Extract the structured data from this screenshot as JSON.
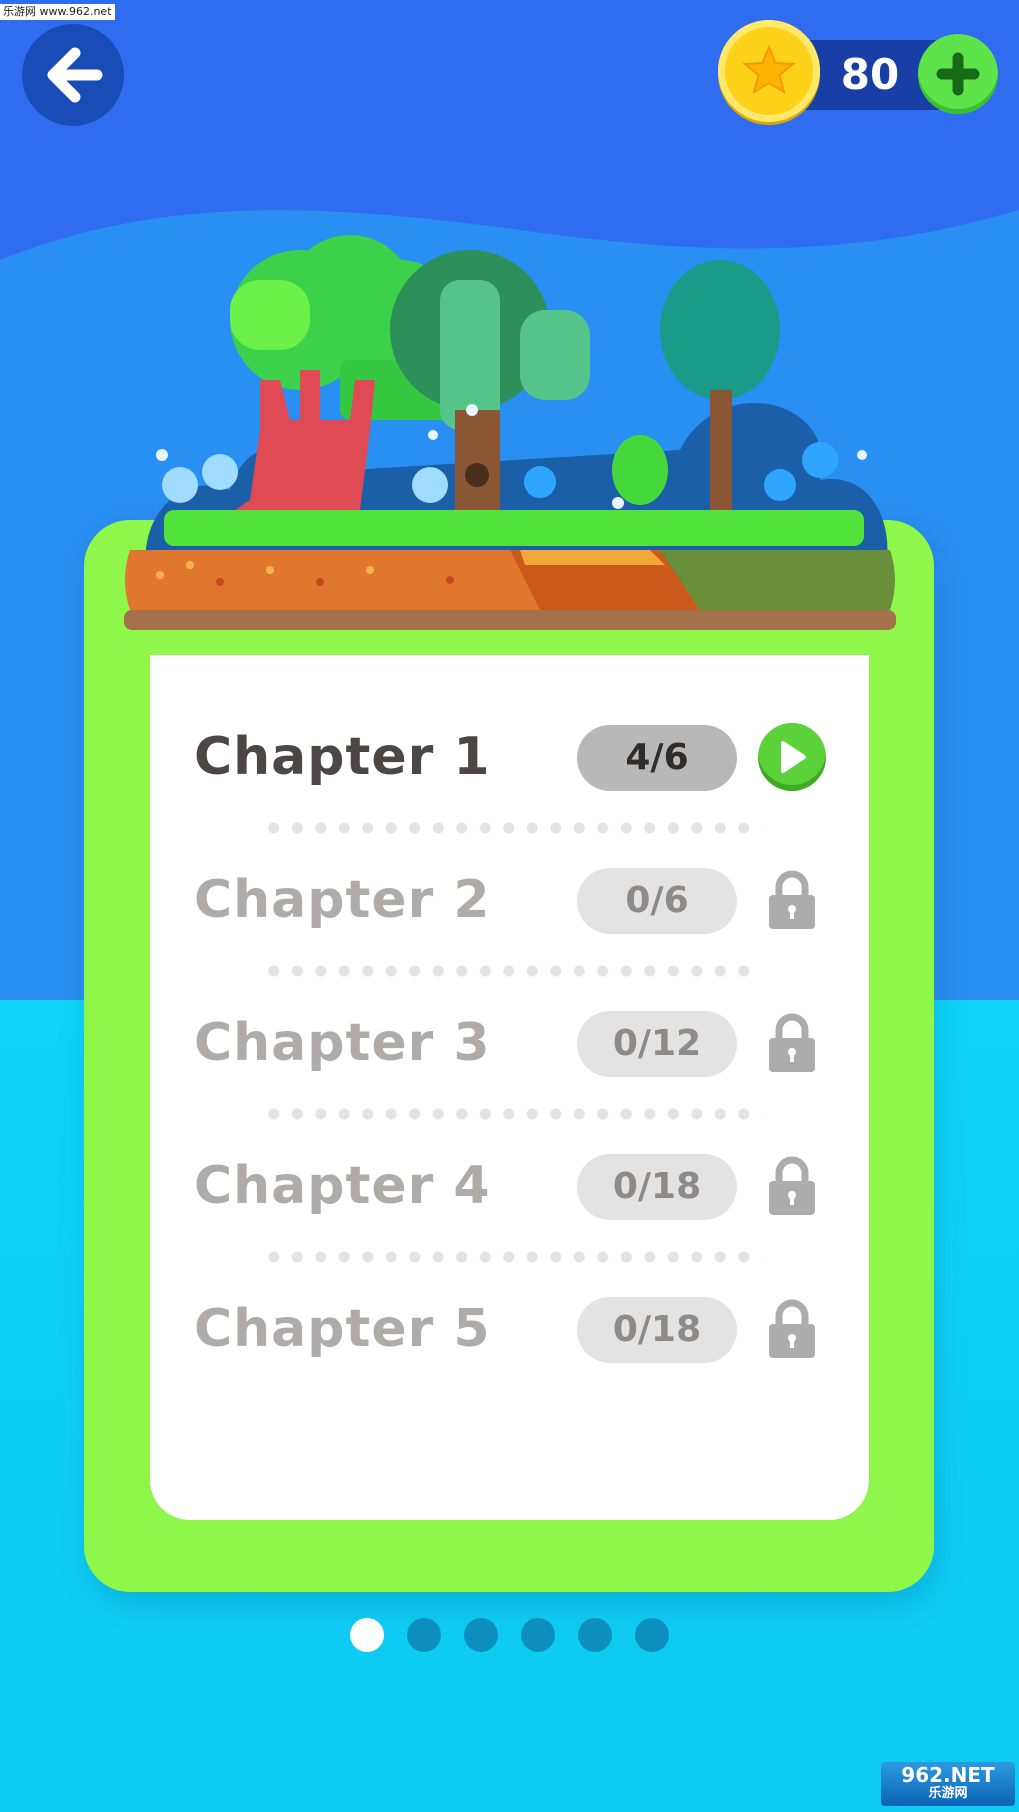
{
  "watermark": {
    "top_text": "乐游网 www.962.net",
    "bottom_line1": "962.NET",
    "bottom_line2": "乐游网"
  },
  "header": {
    "back_icon": "arrow-left-icon",
    "coin_icon": "star-coin-icon",
    "coin_count": "80",
    "add_icon": "plus-icon"
  },
  "chapters": [
    {
      "title": "Chapter 1",
      "progress": "4/6",
      "state": "unlocked"
    },
    {
      "title": "Chapter 2",
      "progress": "0/6",
      "state": "locked"
    },
    {
      "title": "Chapter 3",
      "progress": "0/12",
      "state": "locked"
    },
    {
      "title": "Chapter 4",
      "progress": "0/18",
      "state": "locked"
    },
    {
      "title": "Chapter 5",
      "progress": "0/18",
      "state": "locked"
    }
  ],
  "pager": {
    "page_count": 6,
    "current_page": 1
  },
  "colors": {
    "sky_blue": "#2f6cf0",
    "water_cyan": "#10d0f5",
    "card_green": "#8ef74a",
    "play_green": "#5cd23a",
    "coin_yellow": "#ffd21a"
  }
}
